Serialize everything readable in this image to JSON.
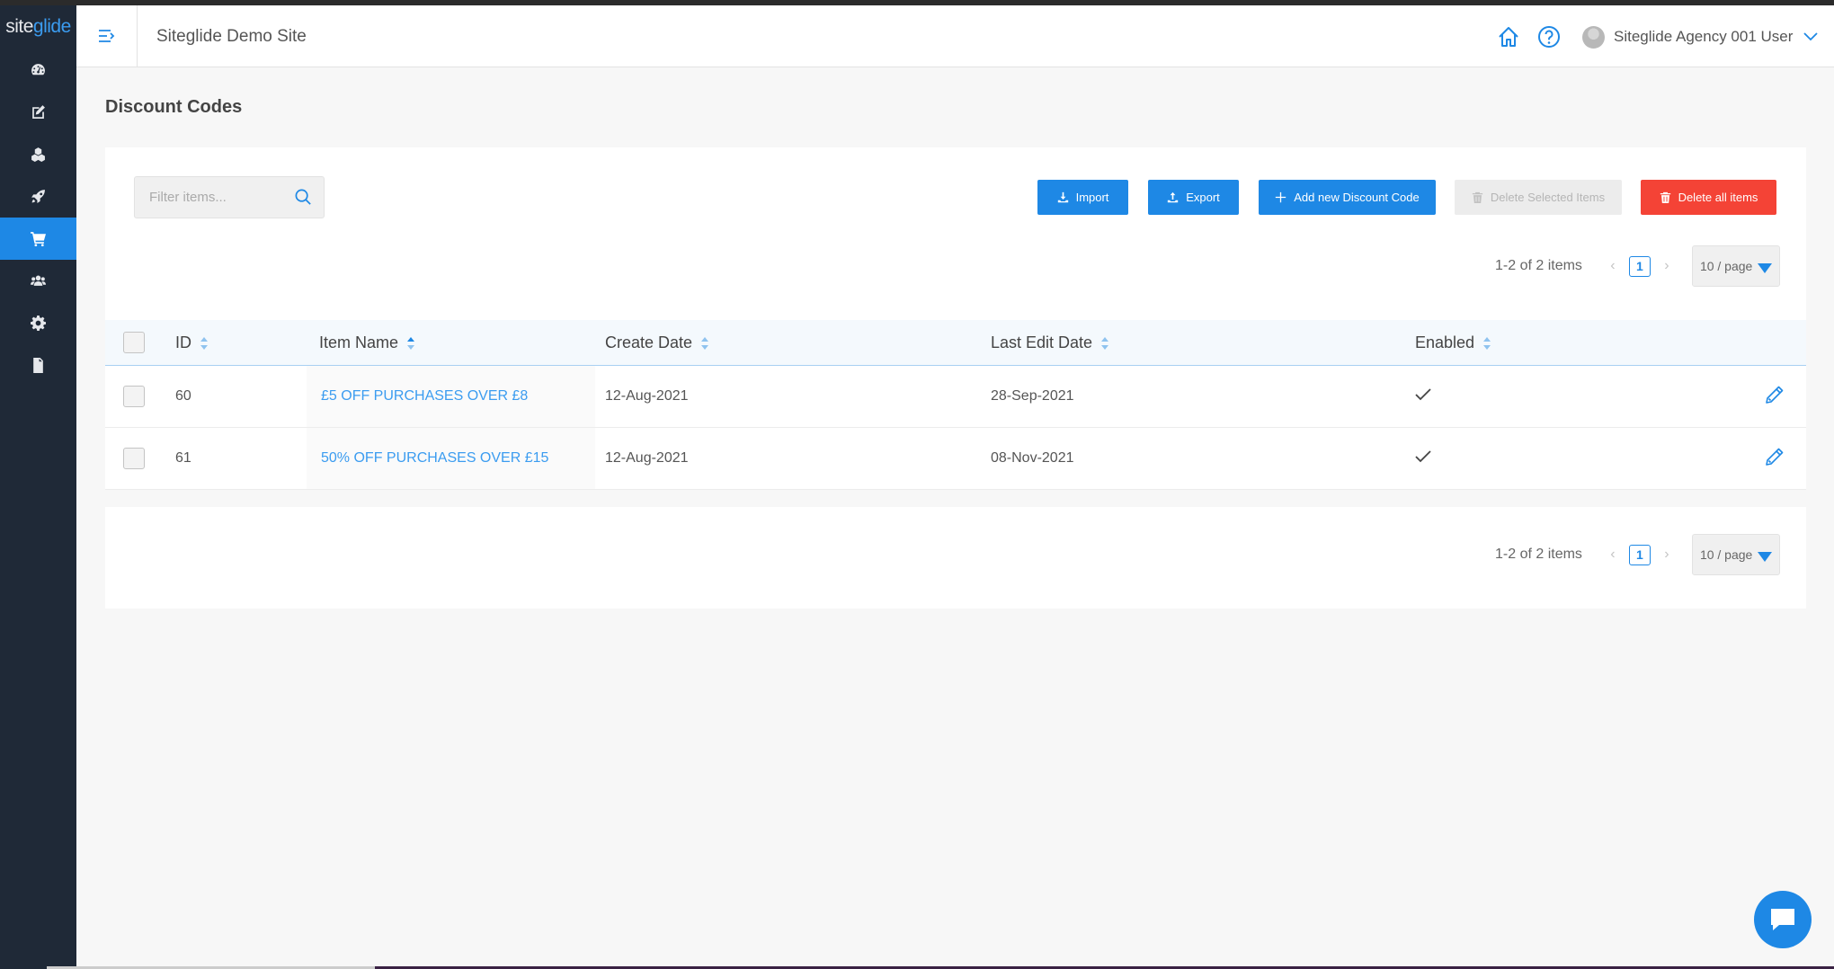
{
  "logo": {
    "part1": "site",
    "part2": "glide"
  },
  "sidebar": {
    "items": [
      {
        "name": "dashboard",
        "icon": "dashboard-icon"
      },
      {
        "name": "edit",
        "icon": "edit-icon"
      },
      {
        "name": "modules",
        "icon": "modules-icon"
      },
      {
        "name": "launch",
        "icon": "rocket-icon"
      },
      {
        "name": "ecommerce",
        "icon": "cart-icon",
        "active": true
      },
      {
        "name": "users",
        "icon": "users-icon"
      },
      {
        "name": "settings",
        "icon": "gear-icon"
      },
      {
        "name": "files",
        "icon": "file-icon"
      }
    ]
  },
  "header": {
    "site_name": "Siteglide Demo Site",
    "user_name": "Siteglide Agency 001 User"
  },
  "page": {
    "title": "Discount Codes"
  },
  "toolbar": {
    "filter_placeholder": "Filter items...",
    "import_label": "Import",
    "export_label": "Export",
    "add_label": "Add new Discount Code",
    "delete_selected_label": "Delete Selected Items",
    "delete_all_label": "Delete all items"
  },
  "pagination": {
    "summary": "1-2 of 2 items",
    "current_page": "1",
    "per_page": "10 / page"
  },
  "table": {
    "columns": [
      "ID",
      "Item Name",
      "Create Date",
      "Last Edit Date",
      "Enabled"
    ],
    "rows": [
      {
        "id": "60",
        "name": "£5 OFF PURCHASES OVER £8",
        "create_date": "12-Aug-2021",
        "edit_date": "28-Sep-2021",
        "enabled": true
      },
      {
        "id": "61",
        "name": "50% OFF PURCHASES OVER £15",
        "create_date": "12-Aug-2021",
        "edit_date": "08-Nov-2021",
        "enabled": true
      }
    ]
  },
  "colors": {
    "accent": "#1e88e5",
    "danger": "#f44336",
    "sidebar": "#1f2937"
  }
}
